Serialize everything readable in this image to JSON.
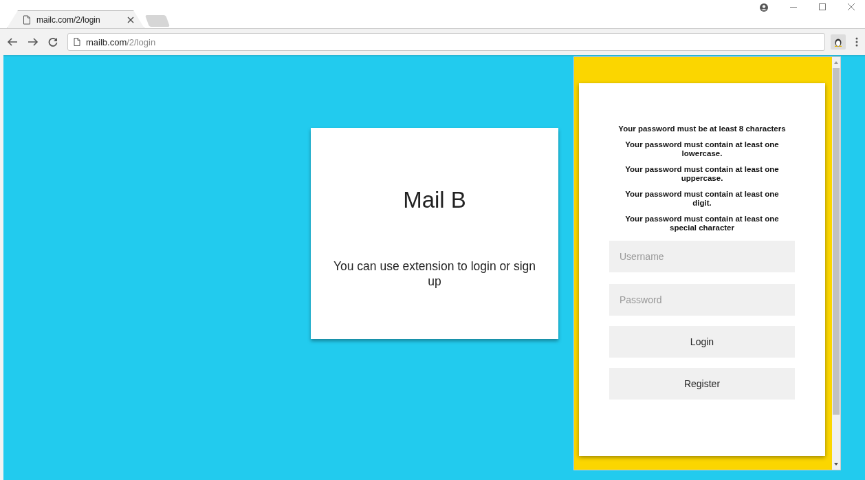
{
  "tabs": [
    {
      "title": "mailc.com/2/login",
      "selected": true
    }
  ],
  "address_bar": {
    "host": "mailb.com",
    "path": "/2/login"
  },
  "page": {
    "title": "Mail B",
    "message": "You can use extension to login or sign up"
  },
  "extension_popup": {
    "rules": [
      "Your password must be at least 8 characters",
      "Your password must contain at least one lowercase.",
      "Your password must contain at least one uppercase.",
      "Your password must contain at least one digit.",
      "Your password must contain at least one special character"
    ],
    "username": {
      "placeholder": "Username"
    },
    "password": {
      "placeholder": "Password"
    },
    "buttons": [
      "Login",
      "Register"
    ]
  }
}
